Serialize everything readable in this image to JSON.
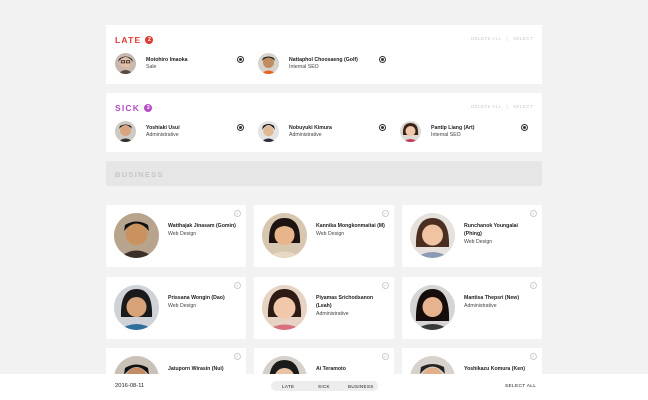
{
  "late": {
    "title": "LATE",
    "count": "2",
    "color": "#e0392f",
    "delete_all": "DELETE ALL",
    "select": "SELECT",
    "people": [
      {
        "name": "Motohiro Imaoka",
        "dept": "Sale"
      },
      {
        "name": "Nattaphol Choosaeng (Golf)",
        "dept": "Internal SEO"
      }
    ]
  },
  "sick": {
    "title": "SICK",
    "count": "3",
    "color": "#b54cc7",
    "delete_all": "DELETE ALL",
    "select": "SELECT",
    "people": [
      {
        "name": "Yoshiaki Usui",
        "dept": "Administrative"
      },
      {
        "name": "Nobuyuki Kimura",
        "dept": "Administrative"
      },
      {
        "name": "Pantip Liang (Art)",
        "dept": "Internal SEO"
      }
    ]
  },
  "business": {
    "title": "BUSINESS"
  },
  "cards": [
    {
      "name": "Watthajak Jinasam (Gomin)",
      "dept": "Web Design"
    },
    {
      "name": "Kannika Mongkonmaitai (M)",
      "dept": "Web Design"
    },
    {
      "name": "Runchanok Youngalai (Phing)",
      "dept": "Web Design"
    },
    {
      "name": "Prissana Wongin (Dao)",
      "dept": "Web Design"
    },
    {
      "name": "Piyamas Srichodsanon (Leah)",
      "dept": "Administrative"
    },
    {
      "name": "Mantisa Thepsri (New)",
      "dept": "Administrative"
    },
    {
      "name": "Jatuporn Wirasin (Nui)",
      "dept": ""
    },
    {
      "name": "Ai Teramoto",
      "dept": ""
    },
    {
      "name": "Yoshikazu Komura (Ken)",
      "dept": ""
    }
  ],
  "footer": {
    "date": "2016-08-11",
    "filters": [
      "LATE",
      "SICK",
      "BUSINESS"
    ],
    "select_all": "SELECT ALL"
  }
}
